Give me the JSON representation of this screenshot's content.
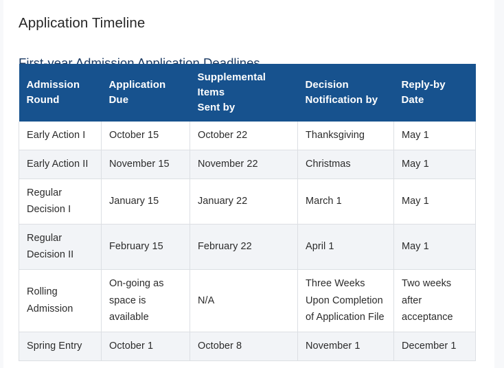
{
  "page": {
    "title": "Application Timeline",
    "table_caption": "First-year Admission Application Deadlines",
    "accent_color": "#17528E",
    "caption_color": "#1B3A63",
    "alt_row_color": "#F2F4F7",
    "border_color": "#DCDFE3"
  },
  "table": {
    "columns": [
      {
        "id": "admission-round",
        "label_line1": "Admission",
        "label_line2": "Round"
      },
      {
        "id": "application-due",
        "label_line1": "Application Due",
        "label_line2": ""
      },
      {
        "id": "supplemental-items-sent-by",
        "label_line1": "Supplemental Items",
        "label_line2": "Sent by"
      },
      {
        "id": "decision-notification-by",
        "label_line1": "Decision",
        "label_line2": "Notification by"
      },
      {
        "id": "reply-by-date",
        "label_line1": "Reply-by",
        "label_line2": "Date"
      }
    ],
    "rows": [
      {
        "round": "Early Action I",
        "application_due": "October 15",
        "supplemental_items": "October 22",
        "decision_notification": "Thanksgiving",
        "reply_by": "May 1"
      },
      {
        "round": "Early Action II",
        "application_due": "November 15",
        "supplemental_items": "November 22",
        "decision_notification": "Christmas",
        "reply_by": "May 1"
      },
      {
        "round": "Regular Decision I",
        "application_due": "January 15",
        "supplemental_items": "January 22",
        "decision_notification": "March 1",
        "reply_by": "May 1"
      },
      {
        "round": "Regular Decision II",
        "application_due": "February 15",
        "supplemental_items": "February 22",
        "decision_notification": "April 1",
        "reply_by": "May 1"
      },
      {
        "round": "Rolling Admission",
        "application_due": "On-going as space is available",
        "supplemental_items": "N/A",
        "decision_notification": "Three Weeks Upon Completion of Application File",
        "reply_by": "Two weeks after acceptance"
      },
      {
        "round": "Spring Entry",
        "application_due": "October 1",
        "supplemental_items": "October 8",
        "decision_notification": "November 1",
        "reply_by": "December 1"
      }
    ]
  }
}
